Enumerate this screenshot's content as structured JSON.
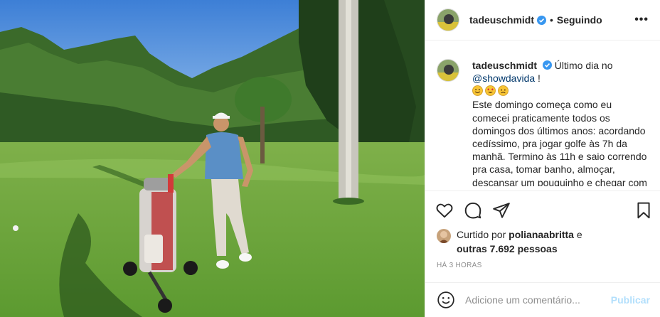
{
  "header": {
    "username": "tadeuschmidt",
    "follow_status": "Seguindo",
    "more_label": "•••",
    "dot": "•"
  },
  "caption": {
    "username": "tadeuschmidt",
    "text_start": "Último dia no",
    "mention": "@showdavida",
    "text_after_mention": "!",
    "emoji_icons": [
      "smiling-face-icon",
      "heart-eyes-icon",
      "worried-face-icon"
    ],
    "body": "Este domingo começa como eu comecei praticamente todos os domingos dos últimos anos: acordando cedíssimo, pra jogar golfe às 7h da manhã. Termino às 11h e saio correndo pra casa, tomar banho, almoçar, descansar um pouquinho e chegar com folga à Globo,"
  },
  "likes": {
    "prefix": "Curtido por",
    "user": "polianaabritta",
    "conj": "e",
    "others": "outras 7.692 pessoas"
  },
  "timestamp": "HÁ 3 HORAS",
  "comment": {
    "placeholder": "Adicione um comentário...",
    "publish_label": "Publicar"
  },
  "colors": {
    "verified": "#3897f0",
    "mention": "#00376b",
    "publish": "#b2dffc",
    "muted": "#8e8e8e"
  }
}
